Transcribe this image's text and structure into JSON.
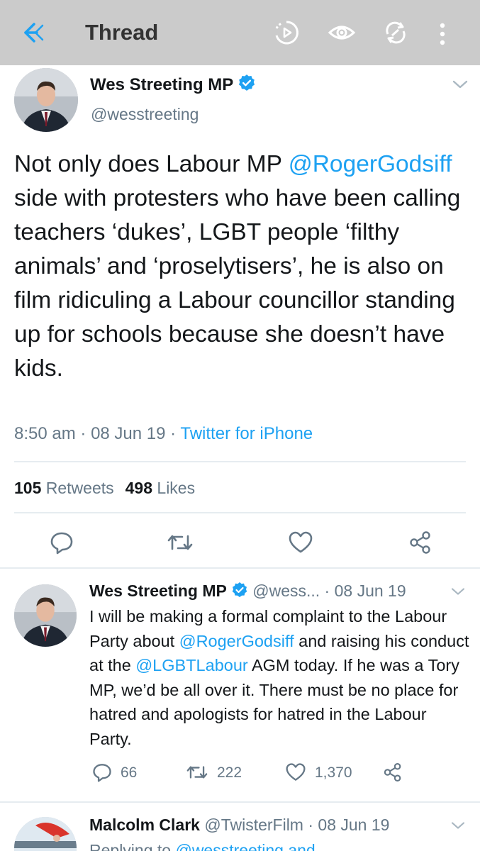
{
  "appbar": {
    "title": "Thread",
    "icons": [
      "back-arrow-icon",
      "data-saver-icon",
      "eye-icon",
      "sync-icon",
      "more-vertical-icon"
    ]
  },
  "main_tweet": {
    "name": "Wes Streeting MP",
    "handle": "@wesstreeting",
    "text_parts": {
      "p1": "Not only does Labour MP ",
      "mention": "@RogerGodsiff",
      "p2": " side with protesters who have been calling teachers ‘dukes’, LGBT people ‘filthy animals’ and ‘proselytisers’, he is also on film ridiculing a Labour councillor standing up for schools because she doesn’t have kids."
    },
    "time": "8:50 am",
    "date": "08 Jun 19",
    "source": "Twitter for iPhone",
    "retweets_count": "105",
    "retweets_label": "Retweets",
    "likes_count": "498",
    "likes_label": "Likes",
    "actions": [
      "reply-icon",
      "retweet-icon",
      "like-icon",
      "share-icon"
    ]
  },
  "reply_1": {
    "name": "Wes Streeting MP",
    "handle": "@wess...",
    "date": "· 08 Jun 19",
    "text_parts": {
      "p1": "I will be making a formal complaint to the Labour Party about ",
      "m1": "@RogerGodsiff",
      "p2": " and raising his conduct at the ",
      "m2": "@LGBTLabour",
      "p3": " AGM today. If he was a Tory MP, we’d be all over it. There must be no place for hatred and apologists for hatred in the Labour Party."
    },
    "replies": "66",
    "retweets": "222",
    "likes": "1,370"
  },
  "reply_2": {
    "name": "Malcolm Clark",
    "handle": "@TwisterFilm",
    "date": "· 08 Jun 19",
    "replying_prefix": "Replying to ",
    "replying_to": "@wesstreeting and"
  },
  "colors": {
    "appbar_bg": "#cbcbcb",
    "accent": "#1da1f2",
    "secondary_text": "#657786",
    "primary_text": "#14171a"
  }
}
